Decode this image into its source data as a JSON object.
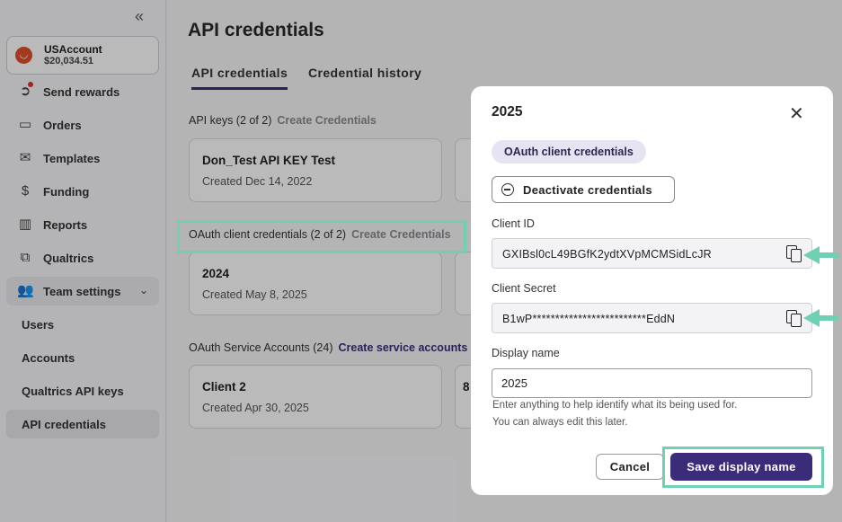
{
  "sidebar": {
    "account": {
      "name": "USAccount",
      "balance": "$20,034.51",
      "logo_icon": "u-logo-icon"
    },
    "items": [
      {
        "label": "Send rewards",
        "icon": "send-icon"
      },
      {
        "label": "Orders",
        "icon": "folder-icon"
      },
      {
        "label": "Templates",
        "icon": "mail-icon"
      },
      {
        "label": "Funding",
        "icon": "dollar-icon"
      },
      {
        "label": "Reports",
        "icon": "bar-chart-icon"
      },
      {
        "label": "Qualtrics",
        "icon": "qualtrics-icon"
      },
      {
        "label": "Team settings",
        "icon": "users-icon"
      }
    ],
    "subitems": [
      {
        "label": "Users"
      },
      {
        "label": "Accounts"
      },
      {
        "label": "Qualtrics API keys"
      },
      {
        "label": "API credentials"
      }
    ]
  },
  "main": {
    "title": "API credentials",
    "tabs": [
      {
        "label": "API credentials"
      },
      {
        "label": "Credential history"
      }
    ],
    "api_keys": {
      "label": "API keys (2 of 2)",
      "link": "Create Credentials",
      "cards": [
        {
          "name": "Don_Test API KEY Test",
          "date": "Created Dec 14, 2022"
        }
      ]
    },
    "oauth": {
      "label": "OAuth client credentials (2 of 2)",
      "link": "Create Credentials",
      "cards": [
        {
          "name": "2024",
          "date": "Created May 8, 2025"
        }
      ]
    },
    "service": {
      "label": "OAuth Service Accounts (24)",
      "link": "Create service accounts",
      "cards": [
        {
          "name": "Client 2",
          "date": "Created Apr 30, 2025"
        },
        {
          "name": "8"
        }
      ]
    }
  },
  "modal": {
    "title": "2025",
    "chip": "OAuth client credentials",
    "deactivate": "Deactivate credentials",
    "client_id_label": "Client ID",
    "client_id": "GXIBsl0cL49BGfK2ydtXVpMCMSidLcJR",
    "client_secret_label": "Client Secret",
    "client_secret": "B1wP*************************EddN",
    "display_label": "Display name",
    "display_value": "2025",
    "help1": "Enter anything to help identify what its being used for.",
    "help2": "You can always edit this later.",
    "cancel": "Cancel",
    "save": "Save display name"
  },
  "colors": {
    "accent": "#3b2c7a",
    "highlight": "#6fd0b3",
    "logo": "#e0502c"
  }
}
